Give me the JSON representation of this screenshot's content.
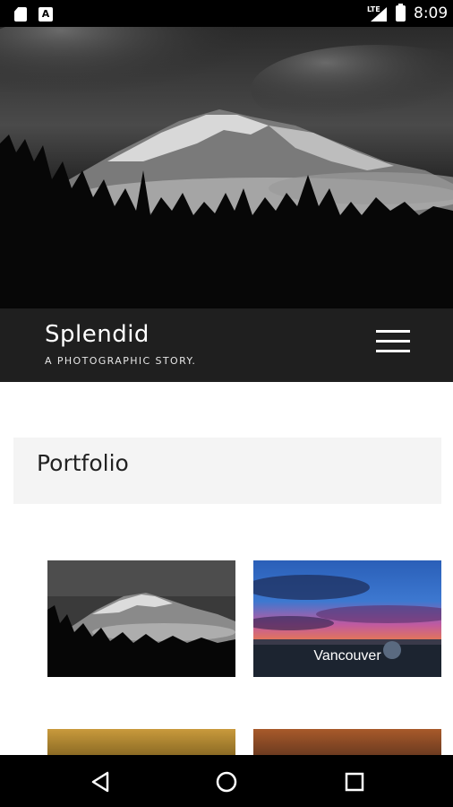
{
  "status_bar": {
    "network": "LTE",
    "time": "8:09",
    "icons": [
      "sd-card-icon",
      "a-notification-icon",
      "signal-icon",
      "battery-icon"
    ]
  },
  "header": {
    "title": "Splendid",
    "tagline": "A PHOTOGRAPHIC STORY.",
    "menu_icon": "hamburger-menu-icon"
  },
  "portfolio": {
    "heading": "Portfolio",
    "items": [
      {
        "label": ""
      },
      {
        "label": "Vancouver"
      },
      {
        "label": ""
      },
      {
        "label": ""
      }
    ]
  },
  "nav_bar": {
    "icons": [
      "back-icon",
      "home-icon",
      "recents-icon"
    ]
  },
  "colors": {
    "header_bg": "#1f1f1f",
    "section_bg": "#f4f4f4",
    "status_bg": "#000000"
  }
}
